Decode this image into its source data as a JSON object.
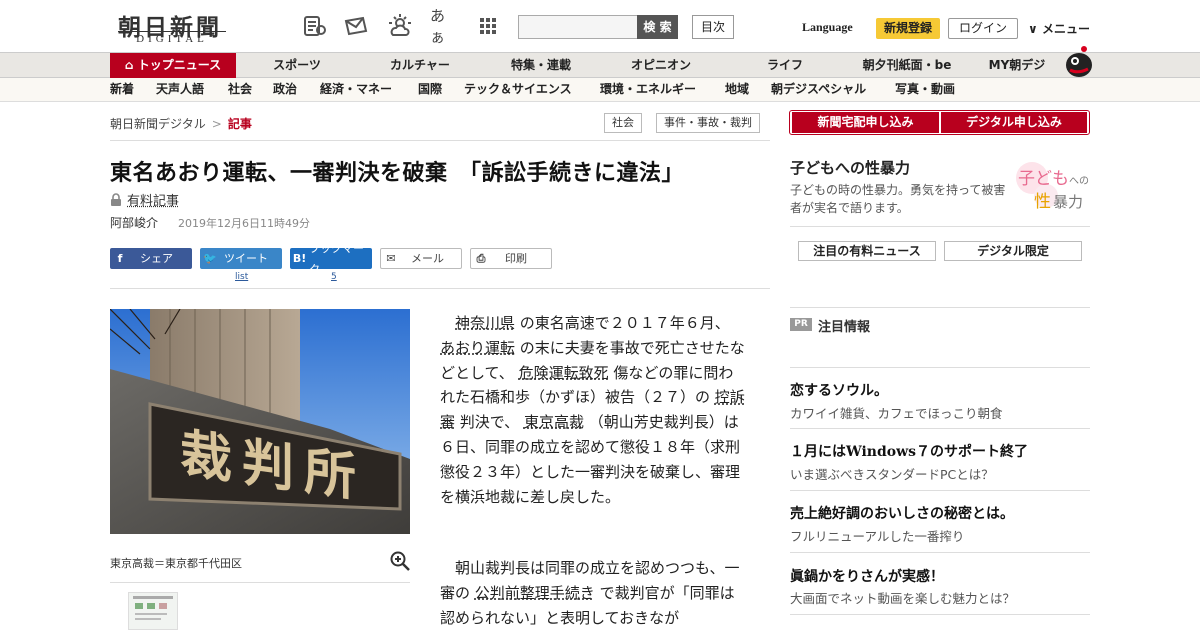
{
  "header": {
    "logo_main": "朝日新聞",
    "logo_sub": "DIGITAL",
    "search_button": "検 索",
    "toc_button": "目次",
    "language": "Language",
    "register": "新規登録",
    "login": "ログイン",
    "menu": "メニュー",
    "font_icon_glyph": "あぁ"
  },
  "nav_primary": {
    "active": "トップニュース",
    "items": [
      "スポーツ",
      "カルチャー",
      "特集・連載",
      "オピニオン",
      "ライフ",
      "朝夕刊紙面・be",
      "MY朝デジ"
    ]
  },
  "nav_secondary": {
    "items": [
      "新着",
      "天声人語",
      "社会",
      "政治",
      "経済・マネー",
      "国際",
      "テック＆サイエンス",
      "環境・エネルギー",
      "地域",
      "朝デジスペシャル",
      "写真・動画"
    ]
  },
  "breadcrumb": {
    "site": "朝日新聞デジタル",
    "separator": ">",
    "current": "記事",
    "tags": [
      "社会",
      "事件・事故・裁判"
    ]
  },
  "article": {
    "headline": "東名あおり運転、一審判決を破棄　「訴訟手続きに違法」",
    "paid_label": "有料記事",
    "author": "阿部峻介",
    "date": "2019年12月6日11時49分",
    "share": {
      "facebook": "シェア",
      "twitter": "ツイート",
      "twitter_count": "list",
      "hatena": "ブックマーク",
      "hatena_count": "5",
      "mail": "メール",
      "print": "印刷"
    },
    "photo_sign": "裁判所",
    "photo_caption": "東京高裁＝東京都千代田区",
    "para1": [
      {
        "t": "　"
      },
      {
        "t": "神奈川県",
        "link": true
      },
      {
        "t": " の東名高速で２０１７年６月、 "
      },
      {
        "t": "あおり運転",
        "link": true
      },
      {
        "t": " の末に夫妻を事故で死亡させたなどとして、 "
      },
      {
        "t": "危険運転致死",
        "link": true
      },
      {
        "t": " 傷などの罪に問われた石橋和歩（かずほ）被告（２７）の "
      },
      {
        "t": "控訴審",
        "link": true
      },
      {
        "t": " 判決で、 "
      },
      {
        "t": "東京高裁",
        "link": true
      },
      {
        "t": " （朝山芳史裁判長）は６日、同罪の成立を認めて懲役１８年（求刑懲役２３年）とした一審判決を破棄し、審理を横浜地裁に差し戻した。"
      }
    ],
    "para2": [
      {
        "t": "　朝山裁判長は同罪の成立を認めつつも、一審の "
      },
      {
        "t": "公判前整理手続き",
        "link": true
      },
      {
        "t": " で裁判官が「同罪は認められない」と表明しておきなが"
      }
    ]
  },
  "sidebar": {
    "subscribe_newspaper": "新聞宅配申し込み",
    "subscribe_digital": "デジタル申し込み",
    "promo_title": "子どもへの性暴力",
    "promo_desc": "子どもの時の性暴力。勇気を持って被害者が実名で語ります。",
    "promo_logo_a": "子ども",
    "promo_logo_b": "への",
    "promo_logo_c": "性",
    "promo_logo_d": "暴力",
    "tab_paid": "注目の有料ニュース",
    "tab_digital": "デジタル限定",
    "pr_badge": "PR",
    "pr_title": "注目情報",
    "ads": [
      {
        "title": "恋するソウル。",
        "desc": "カワイイ雑貨、カフェでほっこり朝食"
      },
      {
        "title": "１月にはWindows７のサポート終了",
        "desc": "いま選ぶべきスタンダードPCとは？"
      },
      {
        "title": "売上絶好調のおいしさの秘密とは。",
        "desc": "フルリニューアルした一番搾り"
      },
      {
        "title": "眞鍋かをりさんが実感！",
        "desc": "大画面でネット動画を楽しむ魅力とは？"
      }
    ]
  },
  "colors": {
    "brand_red": "#b8001e",
    "register_yellow": "#f6c935"
  }
}
